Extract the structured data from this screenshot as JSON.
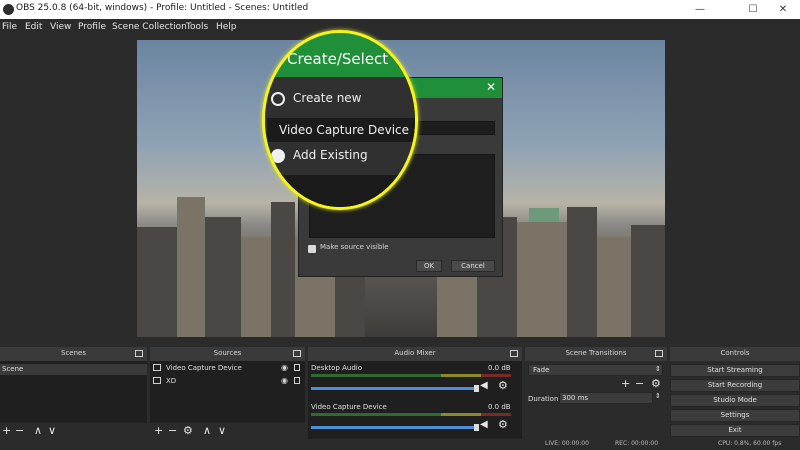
{
  "window": {
    "title": "OBS 25.0.8 (64-bit, windows) - Profile: Untitled - Scenes: Untitled",
    "controls": {
      "minimize": "—",
      "maximize": "☐",
      "close": "✕"
    }
  },
  "menu": [
    "File",
    "Edit",
    "View",
    "Profile",
    "Scene Collection",
    "Tools",
    "Help"
  ],
  "dialog": {
    "close_glyph": "✕",
    "checkbox_label": "Make source visible",
    "ok_label": "OK",
    "cancel_label": "Cancel"
  },
  "magnifier": {
    "header": "Create/Select",
    "option_new": "Create new",
    "new_name_value": "Video Capture Device",
    "option_existing": "Add Existing"
  },
  "docks": {
    "scenes": {
      "title": "Scenes",
      "items": [
        "Scene"
      ]
    },
    "sources": {
      "title": "Sources",
      "items": [
        "Video Capture Device",
        "XD"
      ]
    },
    "mixer": {
      "title": "Audio Mixer",
      "channels": [
        {
          "name": "Desktop Audio",
          "level": "0.0 dB",
          "volume_fraction": 1.0
        },
        {
          "name": "Video Capture Device",
          "level": "0.0 dB",
          "volume_fraction": 1.0
        }
      ]
    },
    "transitions": {
      "title": "Scene Transitions",
      "transition": "Fade",
      "duration_label": "Duration",
      "duration_value": "300 ms"
    },
    "controls": {
      "title": "Controls",
      "buttons": [
        "Start Streaming",
        "Start Recording",
        "Studio Mode",
        "Settings",
        "Exit"
      ]
    }
  },
  "toolbar_glyphs": {
    "add": "+",
    "remove": "−",
    "up": "∧",
    "down": "∨",
    "gear": "⚙"
  },
  "status": {
    "live": "LIVE: 00:00:00",
    "rec": "REC: 00:00:00",
    "cpu": "CPU: 0.8%, 60.00 fps"
  },
  "colors": {
    "obs_green": "#1f8f3a",
    "highlight_yellow": "#f5f51e",
    "volume_blue": "#4a8fd8"
  }
}
